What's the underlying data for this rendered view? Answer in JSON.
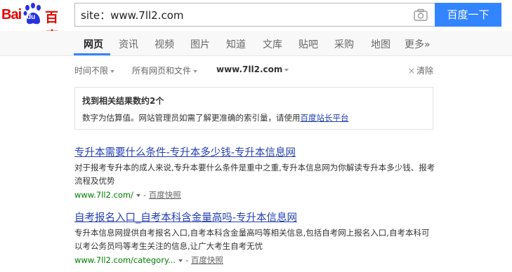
{
  "logo": {
    "bai": "Bai",
    "du": "du",
    "baidu_cn": "百度"
  },
  "search": {
    "query": "site：www.7ll2.com",
    "button_label": "百度一下"
  },
  "tabs": [
    {
      "label": "网页",
      "active": true
    },
    {
      "label": "资讯"
    },
    {
      "label": "视频"
    },
    {
      "label": "图片"
    },
    {
      "label": "知道"
    },
    {
      "label": "文库"
    },
    {
      "label": "贴吧"
    },
    {
      "label": "采购"
    },
    {
      "label": "地图"
    },
    {
      "label": "更多»"
    }
  ],
  "filters": {
    "time": "时间不限",
    "filetype": "所有网页和文件",
    "site": "www.7ll2.com",
    "clear": "清除"
  },
  "info": {
    "title": "找到相关结果数约2个",
    "desc_prefix": "数字为估算值。网站管理员如需了解更准确的索引量，请使用",
    "desc_link": "百度站长平台"
  },
  "results": [
    {
      "title": "专升本需要什么条件-专升本多少钱-专升本信息网",
      "abstract": "对于报考专升本的成人来说,专升本要什么条件是重中之重,专升本信息网为你解读专升本多少钱、报考流程及优势",
      "url": "www.7ll2.com/",
      "separator": "-",
      "cache": "百度快照"
    },
    {
      "title": "自考报名入口_自考本科含金量高吗-专升本信息网",
      "abstract": "专升本信息网提供自考报名入口,自考本科含金量高吗等相关信息,包括自考网上报名入口,自考本科可以考公务员吗等考生关注的信息,让广大考生自考无忧",
      "url": "www.7ll2.com/category...",
      "separator": "-",
      "cache": "百度快照"
    }
  ],
  "colors": {
    "brand_red": "#e10602",
    "brand_blue": "#2932e1",
    "button_blue": "#3385ff",
    "link": "#2440b3",
    "url_green": "#008000"
  }
}
